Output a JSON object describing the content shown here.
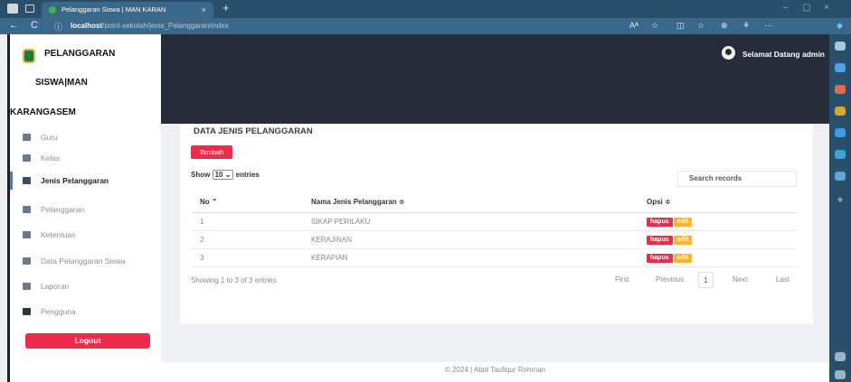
{
  "browser": {
    "tab_title": "Pelanggaran Siswa | MAN KARAN",
    "tab_close": "×",
    "new_tab": "+",
    "url_host": "localhost",
    "url_path": "/point-sekolah/jenis_Pelanggaran/index",
    "back": "←",
    "reload": "C",
    "info": "ⓘ",
    "reader": "Aᴬ",
    "favorite": "☆",
    "minimize": "–",
    "close": "×"
  },
  "sidebar": {
    "brand_line1": "PELANGGARAN",
    "brand_line2": "SISWA|MAN",
    "brand_line3": "KARANGASEM",
    "items": [
      {
        "label": "Guru"
      },
      {
        "label": "Kelas"
      },
      {
        "label": "Jenis Pelanggaran"
      },
      {
        "label": "Pelanggaran"
      },
      {
        "label": "Ketentuan"
      },
      {
        "label": "Data Pelanggaran Siswa"
      },
      {
        "label": "Laporan"
      },
      {
        "label": "Pengguna"
      }
    ],
    "logout_label": "Logout"
  },
  "header": {
    "welcome": "Selamat Datang admin"
  },
  "main": {
    "title": "DATA JENIS PELANGGARAN",
    "add_label": "Tambah",
    "show_label": "Show",
    "show_value": "10 ⌄",
    "entries_label": "entries",
    "search_placeholder": "Search records",
    "columns": [
      "No ⌃",
      "Nama Jenis Pelanggaran ≑",
      "Opsi ≑"
    ],
    "rows": [
      {
        "no": "1",
        "nama": "SIKAP PERILAKU"
      },
      {
        "no": "2",
        "nama": "KERAJINAN"
      },
      {
        "no": "3",
        "nama": "KERAPIAN"
      }
    ],
    "delete_label": "hapus",
    "edit_label": "edit",
    "info_text": "Showing 1 to 3 of 3 entries",
    "pagination": {
      "first": "First",
      "previous": "Previous",
      "current": "1",
      "next": "Next",
      "last": "Last"
    }
  },
  "footer": {
    "text": "© 2024 | Abid Taufiqur Rohman"
  },
  "colors": {
    "accent_red": "#ee2b4a",
    "edit_yellow": "#f7b531",
    "topbar": "#272c3b",
    "browser_frame": "#2a4f6b"
  }
}
